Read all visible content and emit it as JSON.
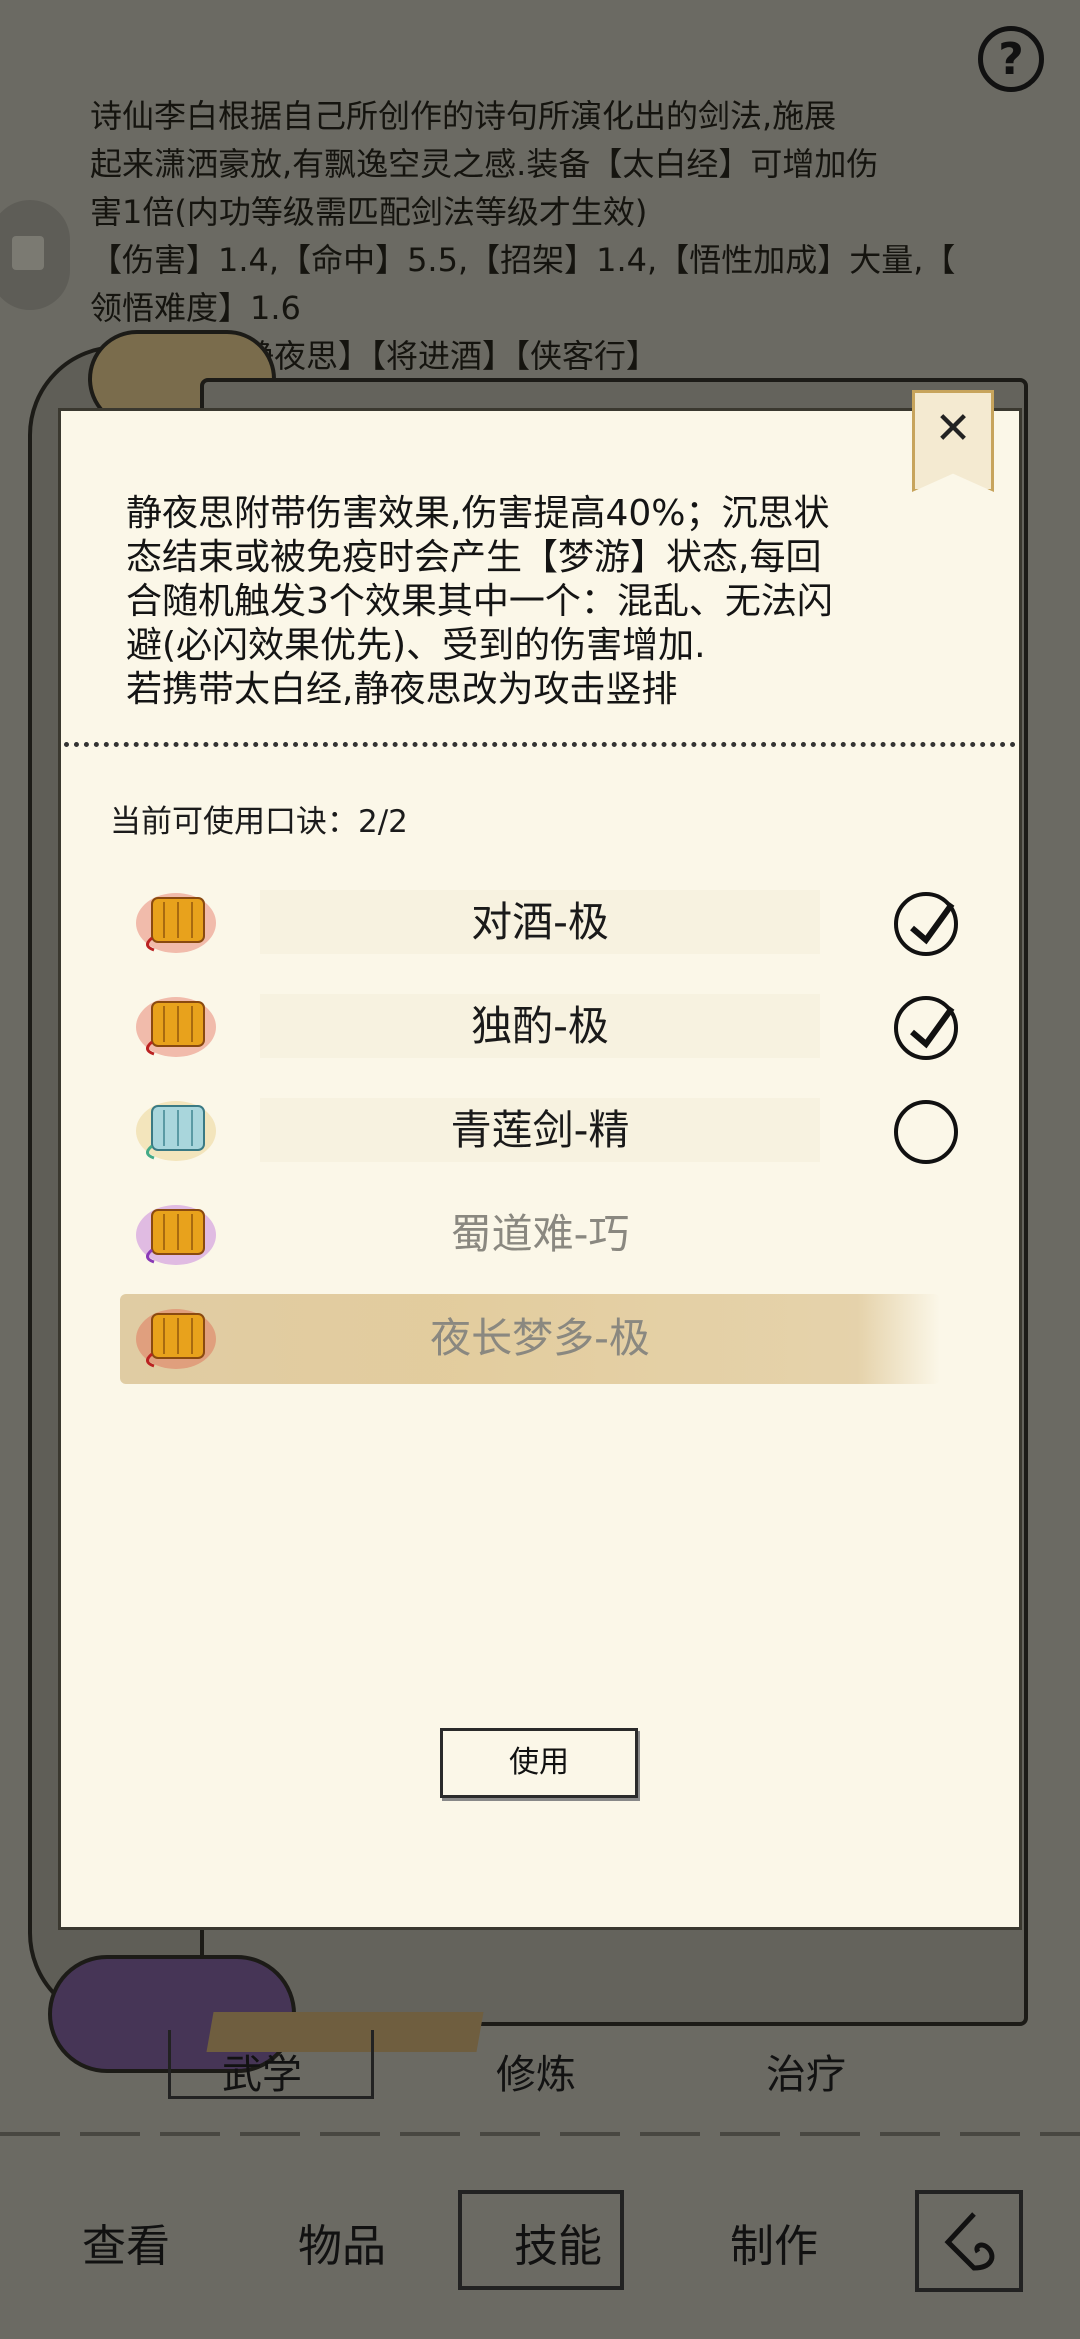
{
  "background": {
    "skill_desc": [
      "诗仙李白根据自己所创作的诗句所演化出的剑法,施展",
      "起来潇洒豪放,有飘逸空灵之感.装备【太白经】可增加伤",
      "害1倍(内功等级需匹配剑法等级才生效)",
      "【伤害】1.4,【命中】5.5,【招架】1.4,【悟性加成】大量,【",
      "领悟难度】1.6",
      "【静夜思】【将进酒】【侠客行】"
    ],
    "help": "?",
    "tabs": [
      "武学",
      "修炼",
      "治疗"
    ]
  },
  "bottom_nav": {
    "items": [
      "查看",
      "物品",
      "技能",
      "制作"
    ],
    "active": "技能",
    "back_icon": "back-icon"
  },
  "dialog": {
    "close": "✕",
    "description": [
      "静夜思附带伤害效果,伤害提高40%；沉思状",
      "态结束或被免疫时会产生【梦游】状态,每回",
      "合随机触发3个效果其中一个：混乱、无法闪",
      "避(必闪效果优先)、受到的伤害增加.",
      "若携带太白经,静夜思改为攻击竖排"
    ],
    "available_label": "当前可使用口诀：2/2",
    "items": [
      {
        "label": "对酒-极",
        "checked": true,
        "color": "#e8a21c",
        "glow": "#e04a3a"
      },
      {
        "label": "独酌-极",
        "checked": true,
        "color": "#e8a21c",
        "glow": "#e04a3a"
      },
      {
        "label": "青莲剑-精",
        "checked": false,
        "color": "#a9d6dc",
        "glow": "#e6c36a"
      },
      {
        "label": "蜀道难-巧",
        "color": "#e8a21c",
        "glow": "#b04ad6"
      },
      {
        "label": "夜长梦多-极",
        "color": "#e8a21c",
        "glow": "#e04a3a"
      }
    ],
    "use_button": "使用"
  }
}
